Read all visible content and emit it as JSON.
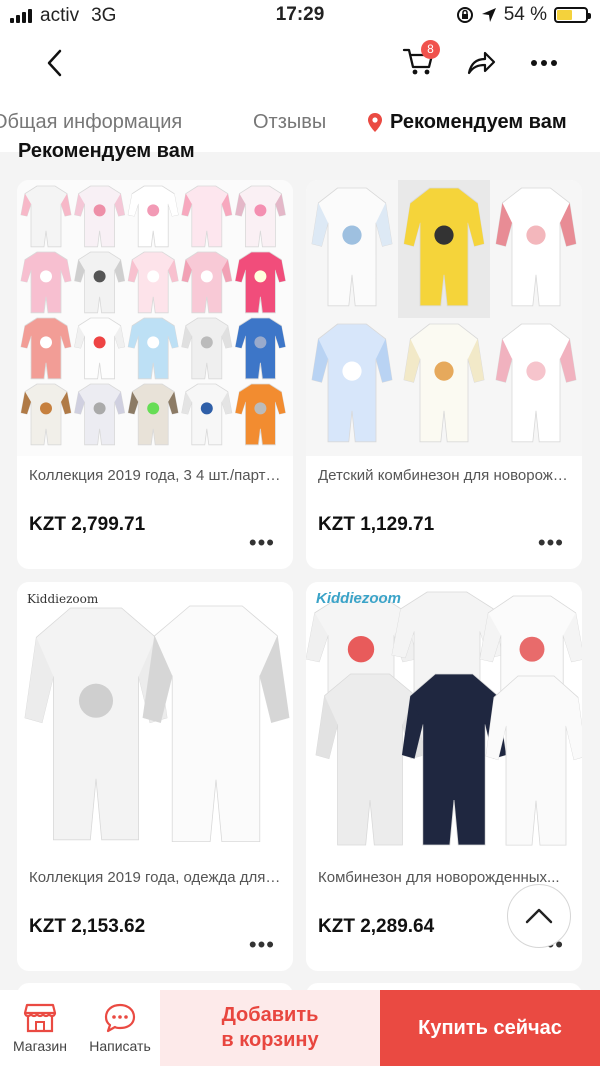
{
  "status_bar": {
    "carrier": "activ",
    "network": "3G",
    "time": "17:29",
    "battery": "54 %",
    "battery_level": 0.54
  },
  "header": {
    "cart_count": "8"
  },
  "tabs": [
    {
      "label": "Общая информация"
    },
    {
      "label": "Отзывы"
    },
    {
      "label": "Рекомендуем вам"
    }
  ],
  "section_title": "Рекомендуем вам",
  "products": [
    {
      "title": "Коллекция 2019 года, 3 4 шт./партия...",
      "price": "KZT 2,799.71"
    },
    {
      "title": "Детский комбинезон для новорожденных...",
      "price": "KZT 1,129.71"
    },
    {
      "title": "Коллекция 2019 года, одежда для новорожденных...",
      "price": "KZT 2,153.62",
      "brand": "Kiddiezoom"
    },
    {
      "title": "Комбинезон для новорожденных...",
      "price": "KZT 2,289.64",
      "brand": "Kiddiezoom"
    }
  ],
  "bottom_bar": {
    "store_label": "Магазин",
    "message_label": "Написать",
    "add_to_cart_label": "Добавить в корзину",
    "buy_now_label": "Купить сейчас"
  },
  "colors": {
    "accent": "#ea4a42",
    "accent_light": "#fdeaea",
    "badge": "#f0524d"
  }
}
